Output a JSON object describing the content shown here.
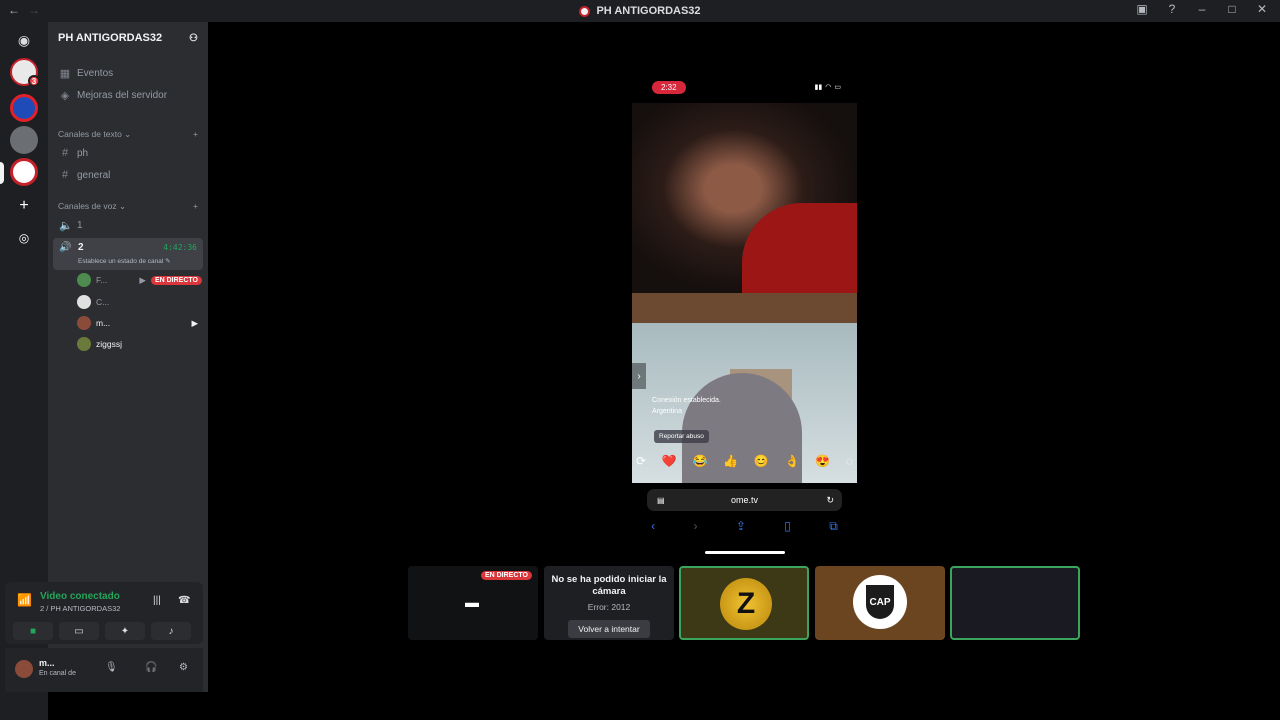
{
  "window": {
    "title": "PH ANTIGORDAS32"
  },
  "server": {
    "name": "PH ANTIGORDAS32"
  },
  "rail": [
    {
      "icon": "discord-home-icon"
    },
    {
      "icon": "server-icon",
      "badge": "3"
    },
    {
      "icon": "server-icon"
    },
    {
      "icon": "server-icon"
    },
    {
      "icon": "server-icon"
    },
    {
      "icon": "add-server-icon"
    },
    {
      "icon": "explore-icon"
    }
  ],
  "menu": {
    "events": "Eventos",
    "boosts": "Mejoras del servidor"
  },
  "text_category": "Canales de texto",
  "text_channels": [
    "ph",
    "general"
  ],
  "voice_category": "Canales de voz",
  "voice_channels": [
    {
      "name": "1"
    },
    {
      "name": "2",
      "timer": "4:42:36",
      "status": "Establece un estado de canal"
    }
  ],
  "voice_users": [
    {
      "name": "F...",
      "badge": "EN DIRECTO"
    },
    {
      "name": "C..."
    },
    {
      "name": "m..."
    },
    {
      "name": "ziggssj"
    }
  ],
  "voice_panel": {
    "title": "Video conectado",
    "subtitle": "2 / PH ANTIGORDAS32"
  },
  "user_panel": {
    "name": "m...",
    "status": "En canal de"
  },
  "phone": {
    "clock": "2:32",
    "connection": "Conexión establecida.",
    "country": "Argentina",
    "report": "Reportar abuso",
    "url": "ome.tv",
    "emojis": [
      "❤️",
      "😂",
      "👍",
      "😊",
      "👌",
      "😍"
    ]
  },
  "tiles": {
    "screen_badge": "EN DIRECTO",
    "error_title": "No se ha podido iniciar la cámara",
    "error_code": "Error: 2012",
    "retry": "Volver a intentar",
    "cap_logo": "CAP"
  }
}
